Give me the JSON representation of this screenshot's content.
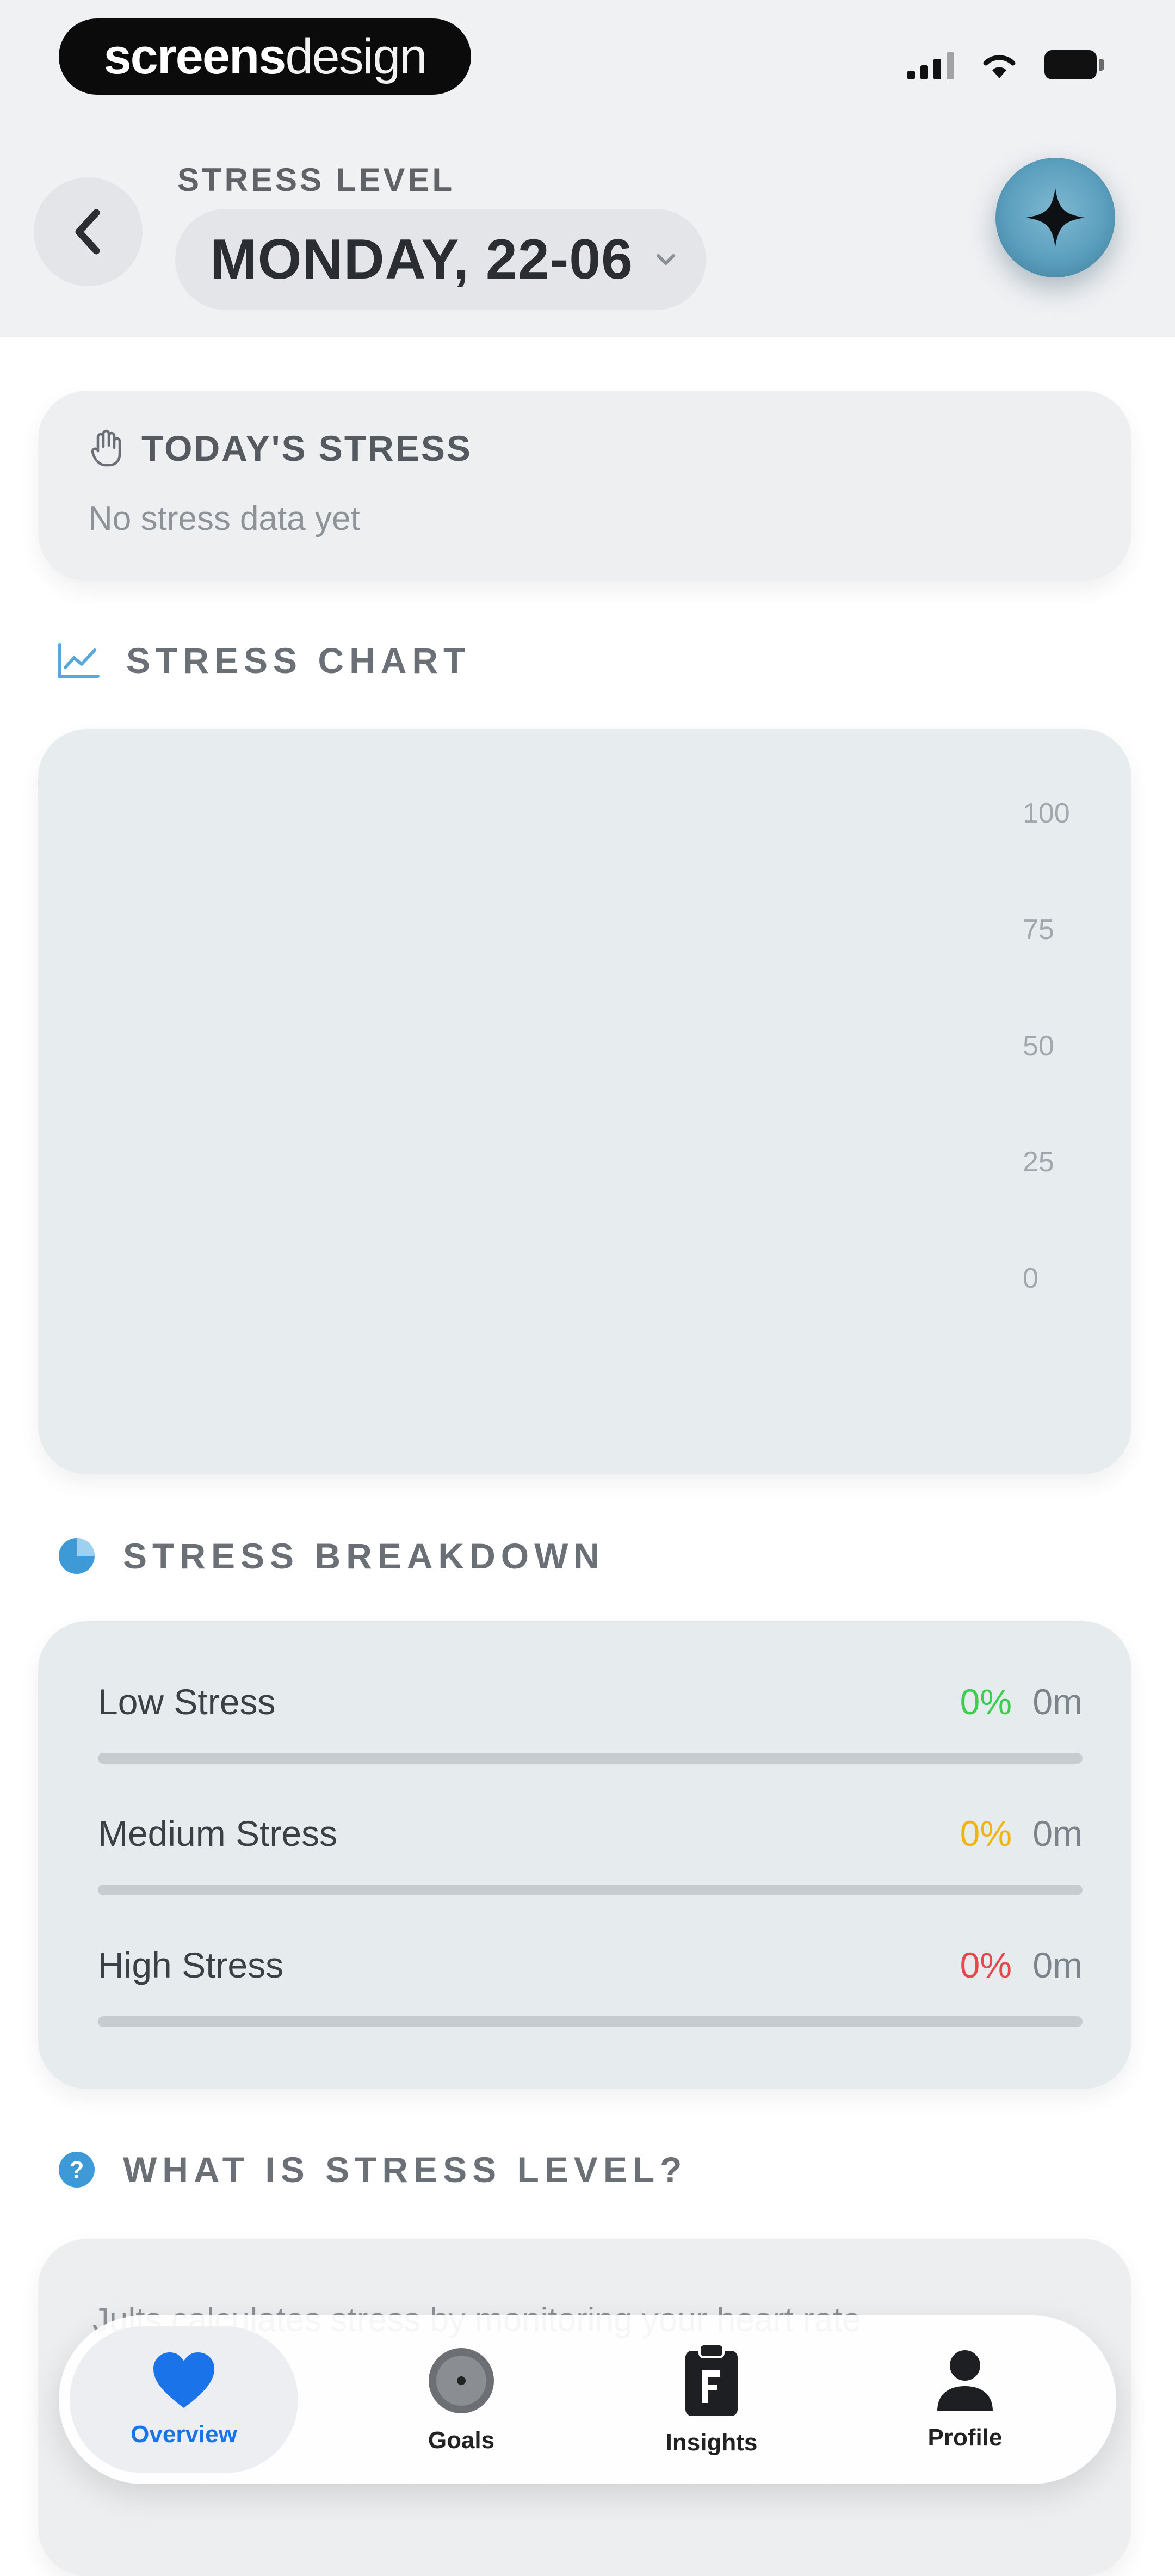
{
  "brand": {
    "part1": "screens",
    "part2": "design"
  },
  "header": {
    "caption": "STRESS LEVEL",
    "date": "MONDAY, 22-06"
  },
  "today": {
    "title": "TODAY'S STRESS",
    "subtitle": "No stress data yet"
  },
  "chart_section": {
    "title": "STRESS CHART"
  },
  "chart_data": {
    "type": "line",
    "x": [],
    "series": [],
    "yticks": [
      "100",
      "75",
      "50",
      "25",
      "0"
    ],
    "ylim": [
      0,
      100
    ],
    "grid": false
  },
  "breakdown": {
    "title": "STRESS BREAKDOWN",
    "rows": [
      {
        "label": "Low Stress",
        "percent": "0%",
        "duration": "0m",
        "color": "#3ccf4e",
        "fraction": 0
      },
      {
        "label": "Medium Stress",
        "percent": "0%",
        "duration": "0m",
        "color": "#f2b30c",
        "fraction": 0
      },
      {
        "label": "High Stress",
        "percent": "0%",
        "duration": "0m",
        "color": "#e5484d",
        "fraction": 0
      }
    ]
  },
  "info": {
    "title": "WHAT IS STRESS LEVEL?",
    "text": "Jults calculates stress by monitoring your heart rate"
  },
  "tabs": [
    {
      "label": "Overview",
      "icon": "heart-icon",
      "active": true
    },
    {
      "label": "Goals",
      "icon": "target-icon",
      "active": false
    },
    {
      "label": "Insights",
      "icon": "clipboard-icon",
      "active": false
    },
    {
      "label": "Profile",
      "icon": "person-icon",
      "active": false
    }
  ],
  "colors": {
    "accent": "#1a73e8",
    "low": "#3ccf4e",
    "medium": "#f2b30c",
    "high": "#e5484d"
  }
}
